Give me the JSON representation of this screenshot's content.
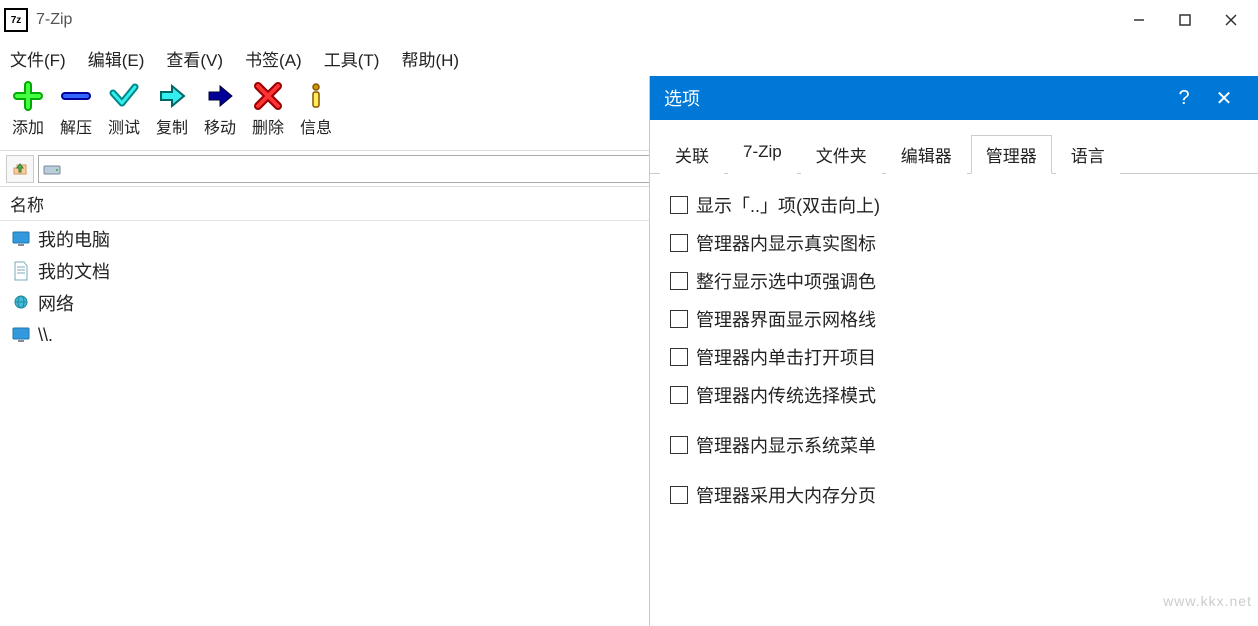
{
  "app": {
    "title": "7-Zip"
  },
  "menubar": {
    "file": "文件(F)",
    "edit": "编辑(E)",
    "view": "查看(V)",
    "bookmarks": "书签(A)",
    "tools": "工具(T)",
    "help": "帮助(H)"
  },
  "toolbar": {
    "add": "添加",
    "extract": "解压",
    "test": "测试",
    "copy": "复制",
    "move": "移动",
    "delete": "删除",
    "info": "信息"
  },
  "path": {
    "value": ""
  },
  "list": {
    "header_name": "名称",
    "items": [
      {
        "label": "我的电脑",
        "icon": "monitor"
      },
      {
        "label": "我的文档",
        "icon": "doc"
      },
      {
        "label": "网络",
        "icon": "network"
      },
      {
        "label": "\\\\.",
        "icon": "monitor"
      }
    ]
  },
  "dialog": {
    "title": "选项",
    "tabs": {
      "assoc": "关联",
      "sevenzip": "7-Zip",
      "folder": "文件夹",
      "editor": "编辑器",
      "manager": "管理器",
      "language": "语言"
    },
    "manager_opts": {
      "show_dotdot": "显示「..」项(双击向上)",
      "real_icons": "管理器内显示真实图标",
      "full_row": "整行显示选中项强调色",
      "gridlines": "管理器界面显示网格线",
      "single_click": "管理器内单击打开项目",
      "classic_select": "管理器内传统选择模式",
      "system_menu": "管理器内显示系统菜单",
      "large_pages": "管理器采用大内存分页"
    }
  },
  "watermark": "www.kkx.net"
}
